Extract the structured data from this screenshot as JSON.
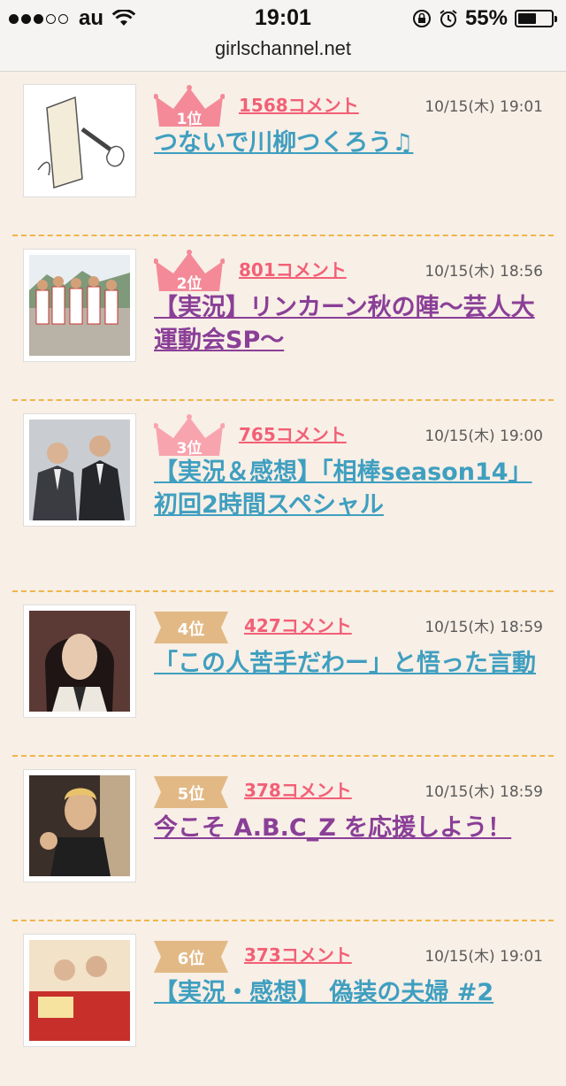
{
  "status": {
    "carrier": "au",
    "time": "19:01",
    "battery": "55%",
    "battery_fraction": 0.55,
    "icons": [
      "signal-dots-icon",
      "wifi-icon",
      "orientation-lock-icon",
      "alarm-icon",
      "battery-icon"
    ]
  },
  "browser": {
    "url": "girlschannel.net"
  },
  "colors": {
    "comment_link": "#f26076",
    "title_blue": "#3f9fc0",
    "title_purple": "#8a3f97",
    "crown": "#f48a98",
    "ribbon": "#e2b985",
    "divider": "#f0b54a"
  },
  "topics": [
    {
      "rank": "1位",
      "comments": "1568コメント",
      "date": "10/15(木) 19:01",
      "title": "つないで川柳つくろう♫",
      "badge": "crown-icon",
      "title_color": "blue"
    },
    {
      "rank": "2位",
      "comments": "801コメント",
      "date": "10/15(木) 18:56",
      "title": "【実況】リンカーン秋の陣〜芸人大運動会SP〜",
      "badge": "crown-icon",
      "title_color": "purple"
    },
    {
      "rank": "3位",
      "comments": "765コメント",
      "date": "10/15(木) 19:00",
      "title": "【実況＆感想】「相棒season14」初回2時間スペシャル",
      "badge": "crown-icon",
      "title_color": "blue"
    },
    {
      "rank": "4位",
      "comments": "427コメント",
      "date": "10/15(木) 18:59",
      "title": "「この人苦手だわー」と悟った言動",
      "badge": "ribbon",
      "title_color": "blue"
    },
    {
      "rank": "5位",
      "comments": "378コメント",
      "date": "10/15(木) 18:59",
      "title": "今こそ A.B.C_Z を応援しよう！",
      "badge": "ribbon",
      "title_color": "purple"
    },
    {
      "rank": "6位",
      "comments": "373コメント",
      "date": "10/15(木) 19:01",
      "title": "【実況・感想】 偽装の夫婦 #2",
      "badge": "ribbon",
      "title_color": "blue"
    }
  ]
}
